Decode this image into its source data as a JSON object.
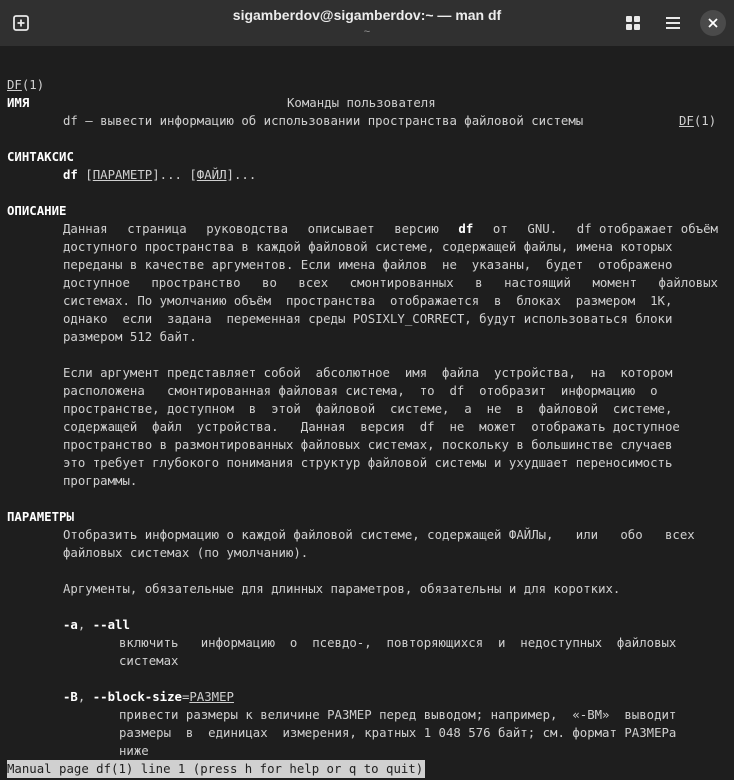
{
  "window": {
    "title": "sigamberdov@sigamberdov:~ — man df",
    "subtitle": "~"
  },
  "man": {
    "header_left": "DF",
    "header_left_suffix": "(1)",
    "header_center": "Команды пользователя",
    "header_right": "DF",
    "header_right_suffix": "(1)",
    "sections": {
      "name_heading": "ИМЯ",
      "name_text": "df — вывести информацию об использовании пространства файловой системы",
      "synopsis_heading": "СИНТАКСИС",
      "synopsis_cmd": "df",
      "synopsis_param": "ПАРАМЕТР",
      "synopsis_file": "ФАЙЛ",
      "description_heading": "ОПИСАНИЕ",
      "options_heading": "ПАРАМЕТРЫ",
      "opt_a_short": "-a",
      "opt_a_long": "--all",
      "opt_B_short": "-B",
      "opt_B_long": "--block-size",
      "opt_B_arg": "РАЗМЕР"
    },
    "desc_lines": [
      [
        "Данная",
        "страница",
        "руководства",
        "описывает",
        "версию",
        "df",
        "от",
        "GNU.",
        "df отображает объём"
      ],
      [
        "доступного пространства в каждой файловой системе, содержащей файлы, имена которых"
      ],
      [
        "переданы в качестве аргументов. Если имена файлов  не  указаны,  будет  отображено"
      ],
      [
        "доступное",
        "пространство",
        "во",
        "всех",
        "смонтированных",
        "в",
        "настоящий",
        "момент",
        "файловых"
      ],
      [
        "системах. По умолчанию объём  пространства  отображается  в  блоках  размером  1K,"
      ],
      [
        "однако  если  задана  переменная среды POSIXLY_CORRECT, будут использоваться блоки"
      ],
      [
        "размером 512 байт."
      ]
    ],
    "desc2_lines": [
      "Если аргумент представляет собой  абсолютное  имя  файла  устройства,  на  котором",
      "расположена   смонтированная файловая система,  то  df  отобразит  информацию  о",
      "пространстве, доступном  в  этой  файловой  системе,  а  не  в  файловой  системе,",
      "содержащей  файл  устройства.   Данная  версия  df  не  может  отображать доступное",
      "пространство в размонтированных файловых системах, поскольку в большинстве случаев",
      "это требует глубокого понимания структур файловой системы и ухудшает переносимость",
      "программы."
    ],
    "opt_lines": [
      "Отобразить информацию о каждой файловой системе, содержащей ФАЙЛы,   или   обо   всех",
      "файловых системах (по умолчанию).",
      "Аргументы, обязательные для длинных параметров, обязательны и для коротких."
    ],
    "opt_a_desc": [
      "включить   информацию  о  псевдо-,  повторяющихся  и  недоступных  файловых",
      "системах"
    ],
    "opt_B_desc": [
      "привести размеры к величине РАЗМЕР перед выводом; например,  «-BM»  выводит",
      "размеры  в  единицах  измерения, кратных 1 048 576 байт; см. формат РАЗМЕРа",
      "ниже"
    ],
    "status": "Manual page df(1) line 1 (press h for help or q to quit)"
  }
}
